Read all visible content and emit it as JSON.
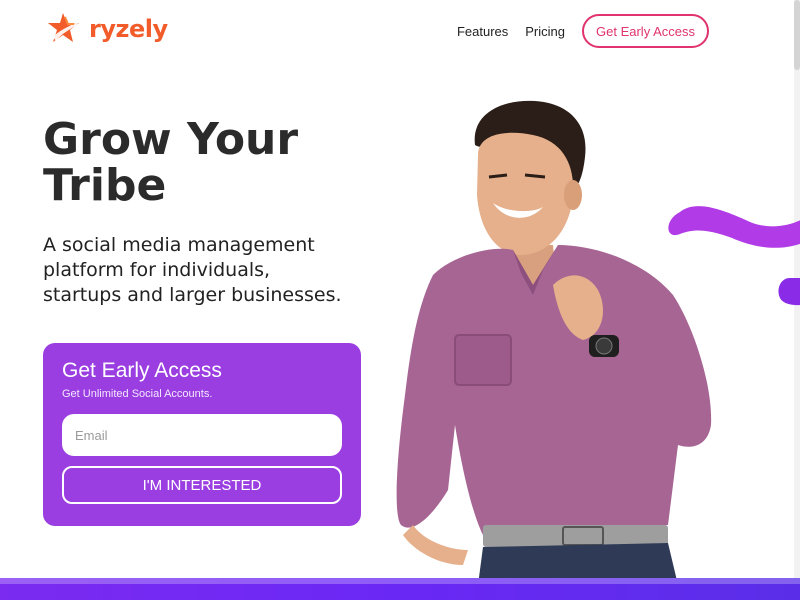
{
  "brand": {
    "name": "ryzely",
    "color": "#f25b2a"
  },
  "nav": {
    "items": [
      {
        "label": "Features"
      },
      {
        "label": "Pricing"
      }
    ],
    "cta_label": "Get Early Access",
    "cta_color": "#e0336f"
  },
  "hero": {
    "title_line1": "Grow Your",
    "title_line2": "Tribe",
    "subtitle": "A social media management platform for individuals, startups and larger businesses."
  },
  "signup": {
    "title": "Get Early Access",
    "subtitle": "Get Unlimited Social Accounts.",
    "email_placeholder": "Email",
    "email_value": "",
    "button_label": "I'M INTERESTED",
    "card_color": "#9b3ee1"
  },
  "icons": {
    "logo": "star-swoosh-icon",
    "photo": "person-photo"
  }
}
